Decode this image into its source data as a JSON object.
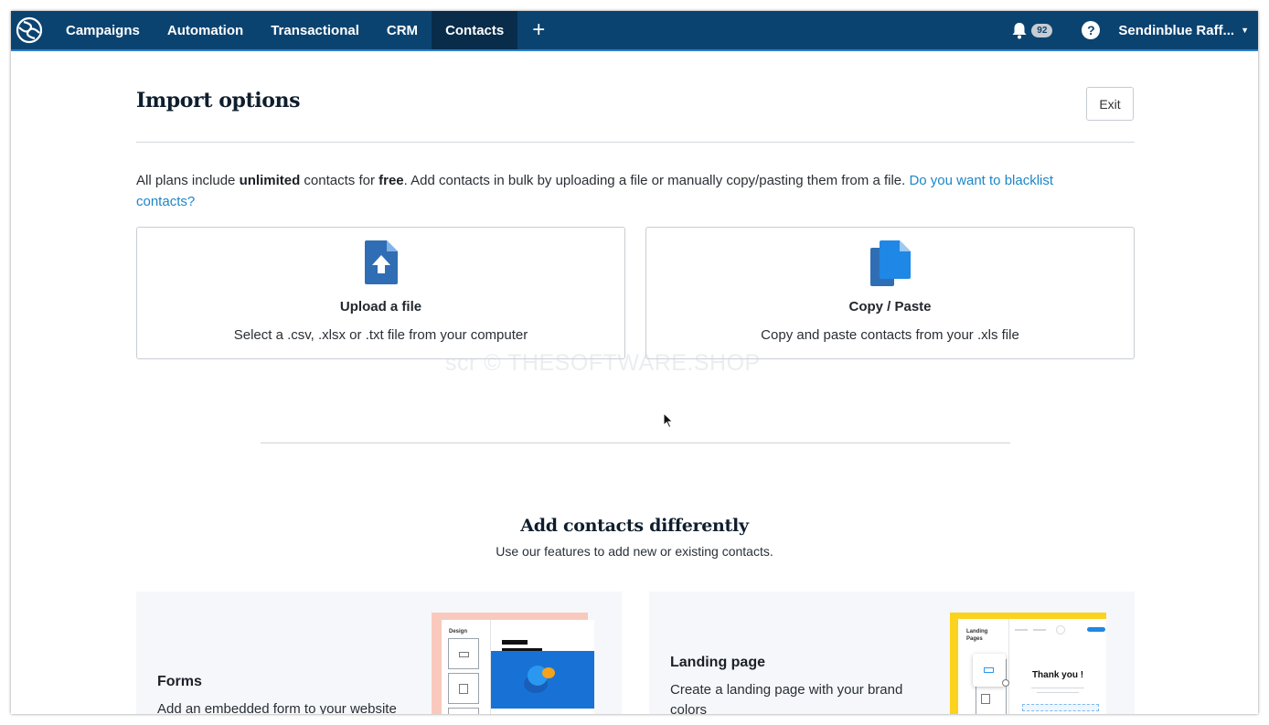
{
  "nav": {
    "items": [
      "Campaigns",
      "Automation",
      "Transactional",
      "CRM",
      "Contacts"
    ],
    "active": "Contacts",
    "add_label": "+",
    "notifications_count": "92",
    "help_label": "?",
    "account_name": "Sendinblue Raff..."
  },
  "colors": {
    "topbar": "#0b4370",
    "link": "#1d86c7",
    "accent": "#2e7fc8"
  },
  "page": {
    "title": "Import options",
    "exit_label": "Exit"
  },
  "intro": {
    "part1": "All plans include ",
    "bold1": "unlimited",
    "part2": " contacts for ",
    "bold2": "free",
    "part3": ". Add contacts in bulk by uploading a file or manually copy/pasting them from a file. ",
    "link": "Do you want to blacklist contacts?"
  },
  "cards": [
    {
      "icon": "file-upload-icon",
      "title": "Upload a file",
      "desc": "Select a .csv, .xlsx or .txt file from your computer"
    },
    {
      "icon": "copy-icon",
      "title": "Copy / Paste",
      "desc": "Copy and paste contacts from your .xls file"
    }
  ],
  "watermark": "scr © THESOFTWARE.SHOP",
  "section": {
    "title": "Add contacts differently",
    "subtitle": "Use our features to add new or existing contacts."
  },
  "features": [
    {
      "title": "Forms",
      "desc": "Add an embedded form to your website",
      "preview_label": "Design"
    },
    {
      "title": "Landing page",
      "desc": "Create a landing page with your brand colors",
      "preview_label_line1": "Landing",
      "preview_label_line2": "Pages",
      "preview_thanks": "Thank you !"
    }
  ]
}
